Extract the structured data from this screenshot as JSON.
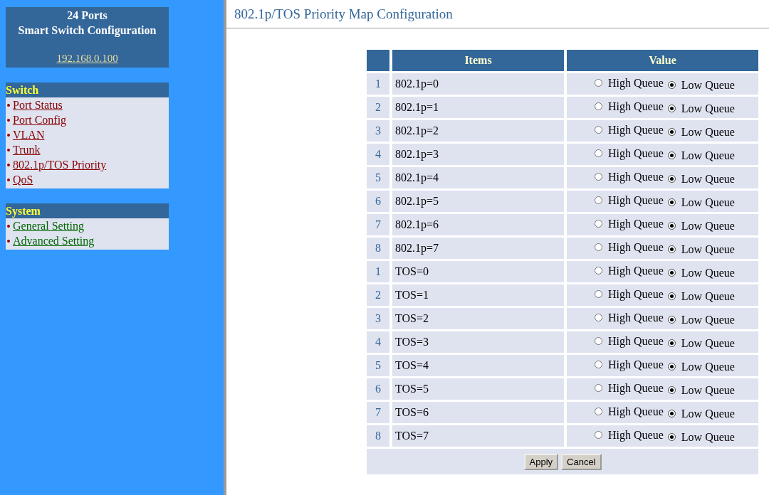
{
  "sidebar": {
    "header": {
      "line_1": "24 Ports",
      "line_2": "Smart Switch Configuration",
      "address": "192.168.0.100"
    },
    "sections": [
      {
        "title": "Switch",
        "kind": "switch",
        "items": [
          "Port Status",
          "Port Config",
          "VLAN",
          "Trunk",
          "802.1p/TOS Priority",
          "QoS"
        ]
      },
      {
        "title": "System",
        "kind": "system",
        "items": [
          "General Setting",
          "Advanced Setting"
        ]
      }
    ]
  },
  "page_title": "802.1p/TOS Priority Map Configuration",
  "table": {
    "columns": [
      "Items",
      "Value"
    ],
    "rows": [
      {
        "number": "1",
        "item": "802.1p=0",
        "options": [
          {
            "label": "High Queue",
            "selected": false
          },
          {
            "label": "Low Queue",
            "selected": true
          }
        ]
      },
      {
        "number": "2",
        "item": "802.1p=1",
        "options": [
          {
            "label": "High Queue",
            "selected": false
          },
          {
            "label": "Low Queue",
            "selected": true
          }
        ]
      },
      {
        "number": "3",
        "item": "802.1p=2",
        "options": [
          {
            "label": "High Queue",
            "selected": false
          },
          {
            "label": "Low Queue",
            "selected": true
          }
        ]
      },
      {
        "number": "4",
        "item": "802.1p=3",
        "options": [
          {
            "label": "High Queue",
            "selected": false
          },
          {
            "label": "Low Queue",
            "selected": true
          }
        ]
      },
      {
        "number": "5",
        "item": "802.1p=4",
        "options": [
          {
            "label": "High Queue",
            "selected": false
          },
          {
            "label": "Low Queue",
            "selected": true
          }
        ]
      },
      {
        "number": "6",
        "item": "802.1p=5",
        "options": [
          {
            "label": "High Queue",
            "selected": false
          },
          {
            "label": "Low Queue",
            "selected": true
          }
        ]
      },
      {
        "number": "7",
        "item": "802.1p=6",
        "options": [
          {
            "label": "High Queue",
            "selected": false
          },
          {
            "label": "Low Queue",
            "selected": true
          }
        ]
      },
      {
        "number": "8",
        "item": "802.1p=7",
        "options": [
          {
            "label": "High Queue",
            "selected": false
          },
          {
            "label": "Low Queue",
            "selected": true
          }
        ]
      },
      {
        "number": "1",
        "item": "TOS=0",
        "options": [
          {
            "label": "High Queue",
            "selected": false
          },
          {
            "label": "Low Queue",
            "selected": true
          }
        ]
      },
      {
        "number": "2",
        "item": "TOS=1",
        "options": [
          {
            "label": "High Queue",
            "selected": false
          },
          {
            "label": "Low Queue",
            "selected": true
          }
        ]
      },
      {
        "number": "3",
        "item": "TOS=2",
        "options": [
          {
            "label": "High Queue",
            "selected": false
          },
          {
            "label": "Low Queue",
            "selected": true
          }
        ]
      },
      {
        "number": "4",
        "item": "TOS=3",
        "options": [
          {
            "label": "High Queue",
            "selected": false
          },
          {
            "label": "Low Queue",
            "selected": true
          }
        ]
      },
      {
        "number": "5",
        "item": "TOS=4",
        "options": [
          {
            "label": "High Queue",
            "selected": false
          },
          {
            "label": "Low Queue",
            "selected": true
          }
        ]
      },
      {
        "number": "6",
        "item": "TOS=5",
        "options": [
          {
            "label": "High Queue",
            "selected": false
          },
          {
            "label": "Low Queue",
            "selected": true
          }
        ]
      },
      {
        "number": "7",
        "item": "TOS=6",
        "options": [
          {
            "label": "High Queue",
            "selected": false
          },
          {
            "label": "Low Queue",
            "selected": true
          }
        ]
      },
      {
        "number": "8",
        "item": "TOS=7",
        "options": [
          {
            "label": "High Queue",
            "selected": false
          },
          {
            "label": "Low Queue",
            "selected": true
          }
        ]
      }
    ]
  },
  "buttons": [
    "Apply",
    "Cancel"
  ]
}
